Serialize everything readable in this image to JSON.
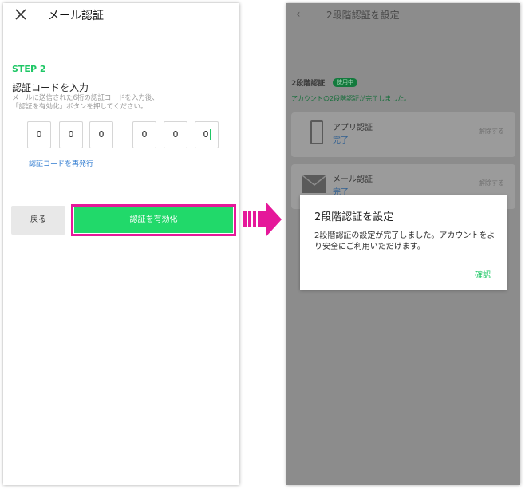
{
  "left": {
    "header_title": "メール認証",
    "step": "STEP 2",
    "heading": "認証コードを入力",
    "description": "メールに送信された6桁の認証コードを入力後、\n「認証を有効化」ボタンを押してください。",
    "code_digits": [
      "0",
      "0",
      "0",
      "0",
      "0",
      "0"
    ],
    "resend_link": "認証コードを再発行",
    "back_button": "戻る",
    "enable_button": "認証を有効化"
  },
  "right": {
    "header_title": "2段階認証を設定",
    "section_title": "2段階認証",
    "section_badge": "使用中",
    "status_text": "アカウントの2段階認証が完了しました。",
    "app_card_title": "アプリ認証",
    "app_card_status": "完了",
    "app_card_action": "解除する",
    "mail_card_title": "メール認証",
    "mail_card_status": "完了",
    "mail_card_action": "解除する"
  },
  "dialog": {
    "title": "2段階認証を設定",
    "message": "2段階認証の設定が完了しました。アカウントをより安全にご利用いただけます。",
    "confirm": "確認"
  },
  "colors": {
    "accent_green": "#21d96a",
    "highlight_magenta": "#e5189a",
    "link_blue": "#2f7bd0"
  }
}
